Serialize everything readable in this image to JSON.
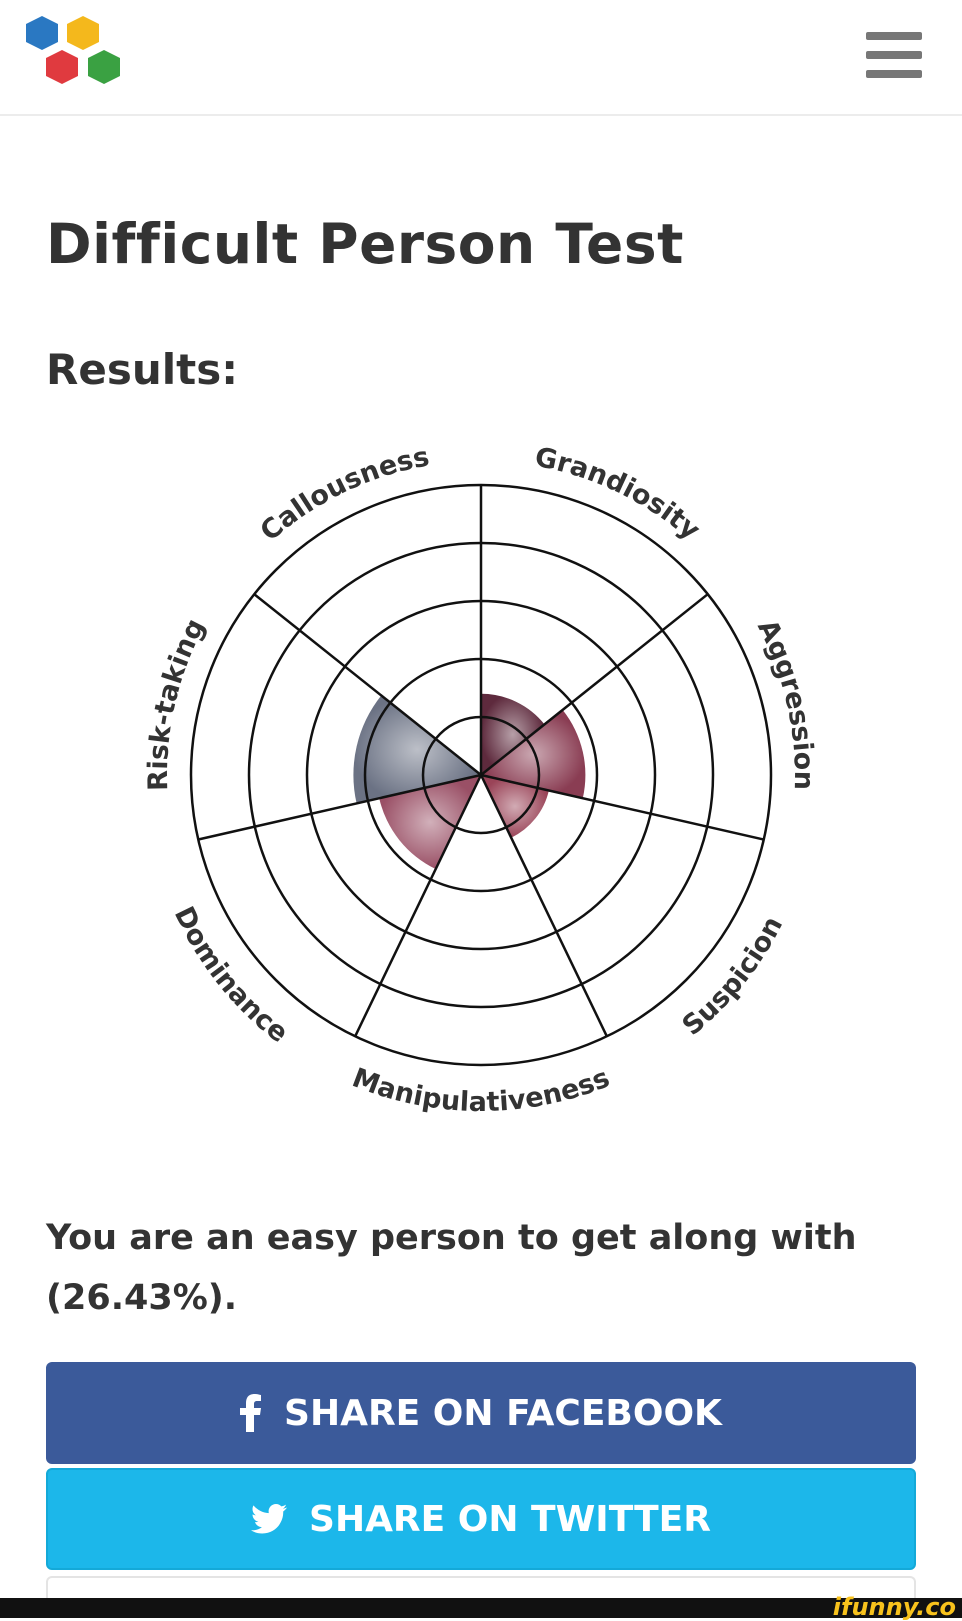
{
  "header": {
    "menu_icon": "hamburger-menu-icon",
    "logo_icon": "hexagon-logo-icon"
  },
  "page": {
    "title": "Difficult Person Test",
    "results_heading": "Results:",
    "result_text": "You are an easy person to get along with (26.43%)."
  },
  "chart_data": {
    "type": "polar-area",
    "ring_max": 5,
    "categories": [
      "Grandiosity",
      "Aggression",
      "Suspicion",
      "Manipulativeness",
      "Dominance",
      "Risk-taking",
      "Callousness"
    ],
    "values": [
      1.4,
      1.8,
      1.2,
      0.4,
      1.8,
      2.2,
      0.0
    ],
    "colors": [
      "#5e2a3d",
      "#8a3d53",
      "#9a4458",
      "#ffffff",
      "#9a5066",
      "#6b7284",
      "#ffffff"
    ]
  },
  "buttons": {
    "facebook_label": "SHARE ON FACEBOOK",
    "twitter_label": "SHARE ON TWITTER",
    "facebook_icon": "facebook-icon",
    "twitter_icon": "twitter-icon"
  },
  "footer": {
    "watermark": "ifunny.co"
  }
}
